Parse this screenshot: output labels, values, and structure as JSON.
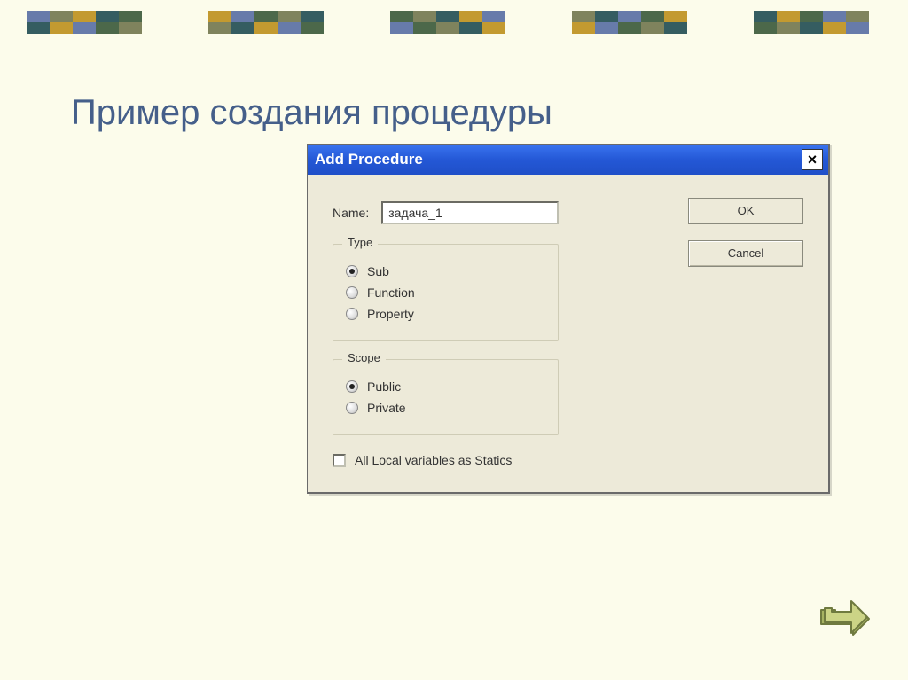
{
  "slide": {
    "title": "Пример создания процедуры"
  },
  "dialog": {
    "title": "Add Procedure",
    "close": "×",
    "name_label": "Name:",
    "name_value": "задача_1",
    "type_group": {
      "legend": "Type",
      "options": {
        "sub": "Sub",
        "function": "Function",
        "property": "Property"
      }
    },
    "scope_group": {
      "legend": "Scope",
      "options": {
        "public": "Public",
        "private": "Private"
      }
    },
    "checkbox_label": "All Local variables as Statics",
    "ok": "OK",
    "cancel": "Cancel"
  }
}
